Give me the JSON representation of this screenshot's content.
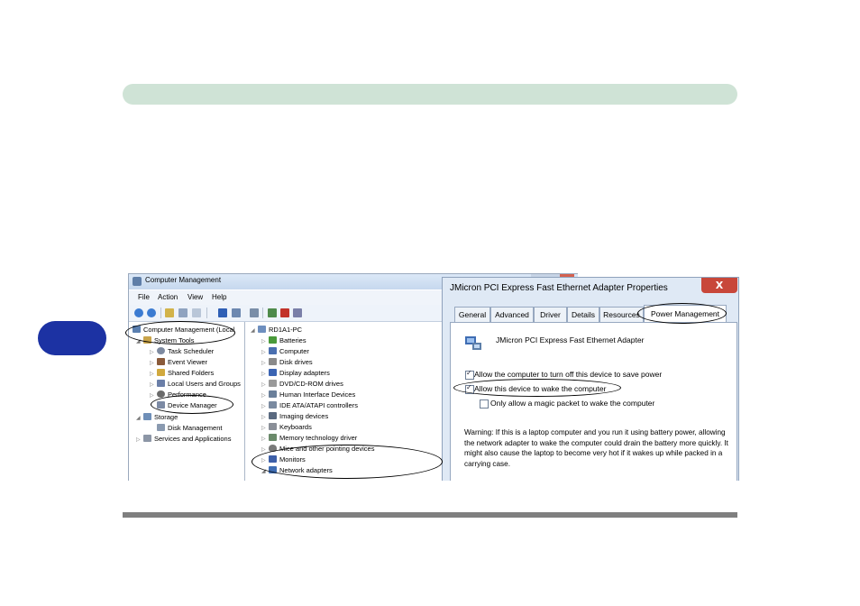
{
  "computer_management": {
    "title": "Computer Management",
    "menu": [
      "File",
      "Action",
      "View",
      "Help"
    ],
    "left_tree": [
      {
        "label": "Computer Management (Local",
        "expander": "",
        "icon_color": "#5a7fb0"
      },
      {
        "label": "System Tools",
        "expander": "◢",
        "icon_color": "#c9a44a"
      },
      {
        "label": "Task Scheduler",
        "expander": "▷",
        "icon_color": "#7d8aa0"
      },
      {
        "label": "Event Viewer",
        "expander": "▷",
        "icon_color": "#8a5a3a"
      },
      {
        "label": "Shared Folders",
        "expander": "▷",
        "icon_color": "#d1a93e"
      },
      {
        "label": "Local Users and Groups",
        "expander": "▷",
        "icon_color": "#6b7fa8"
      },
      {
        "label": "Performance",
        "expander": "▷",
        "icon_color": "#6a6a6a"
      },
      {
        "label": "Device Manager",
        "expander": "",
        "icon_color": "#7c8aa4"
      },
      {
        "label": "Storage",
        "expander": "◢",
        "icon_color": "#6f8fb8"
      },
      {
        "label": "Disk Management",
        "expander": "",
        "icon_color": "#8a9ab0"
      },
      {
        "label": "Services and Applications",
        "expander": "▷",
        "icon_color": "#8c96a6"
      }
    ],
    "device_tree": [
      {
        "label": "RD1A1-PC",
        "expander": "◢",
        "icon_color": "#6e8fbf"
      },
      {
        "label": "Batteries",
        "expander": "▷",
        "icon_color": "#4a9a3a"
      },
      {
        "label": "Computer",
        "expander": "▷",
        "icon_color": "#4a6fb0"
      },
      {
        "label": "Disk drives",
        "expander": "▷",
        "icon_color": "#8a8a8a"
      },
      {
        "label": "Display adapters",
        "expander": "▷",
        "icon_color": "#3b64b3"
      },
      {
        "label": "DVD/CD-ROM drives",
        "expander": "▷",
        "icon_color": "#9a9a9a"
      },
      {
        "label": "Human Interface Devices",
        "expander": "▷",
        "icon_color": "#6a7f9a"
      },
      {
        "label": "IDE ATA/ATAPI controllers",
        "expander": "▷",
        "icon_color": "#7a8aa0"
      },
      {
        "label": "Imaging devices",
        "expander": "▷",
        "icon_color": "#5a6a80"
      },
      {
        "label": "Keyboards",
        "expander": "▷",
        "icon_color": "#8a8f98"
      },
      {
        "label": "Memory technology driver",
        "expander": "▷",
        "icon_color": "#6a8a6a"
      },
      {
        "label": "Mice and other pointing devices",
        "expander": "▷",
        "icon_color": "#7a7a7a"
      },
      {
        "label": "Monitors",
        "expander": "▷",
        "icon_color": "#3d5fa8"
      },
      {
        "label": "Network adapters",
        "expander": "◢",
        "icon_color": "#3f6db3"
      }
    ]
  },
  "properties_dialog": {
    "title": "JMicron PCI Express Fast Ethernet Adapter Properties",
    "close": "X",
    "tabs": [
      "General",
      "Advanced",
      "Driver",
      "Details",
      "Resources",
      "Power Management"
    ],
    "active_tab": "Power Management",
    "device_name": "JMicron PCI Express Fast Ethernet Adapter",
    "options": [
      {
        "label": "Allow the computer to turn off this device to save power",
        "checked": true
      },
      {
        "label": "Allow this device to wake the computer",
        "checked": true
      },
      {
        "label": "Only allow a magic packet to wake the computer",
        "checked": false
      }
    ],
    "warning": "Warning: If this is a laptop computer and you run it using battery power, allowing the network adapter to wake the computer could drain the battery more quickly. It might also cause the laptop to become very hot if it wakes up while packed in a carrying case."
  }
}
